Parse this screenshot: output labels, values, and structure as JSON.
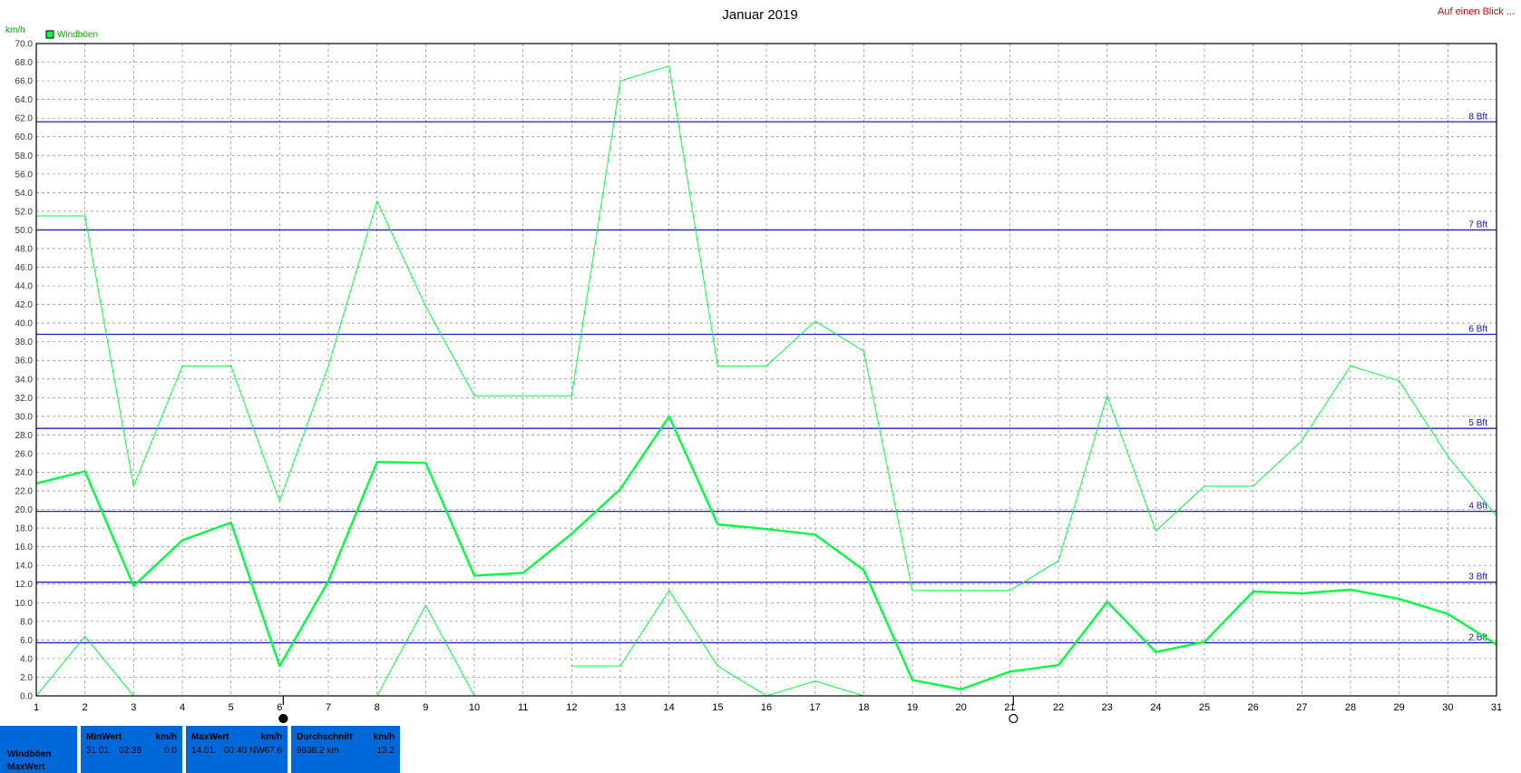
{
  "page": {
    "corner_link": "Auf einen Blick ..."
  },
  "chart_data": {
    "type": "line",
    "title": "Januar 2019",
    "ylabel": "km/h",
    "ylim": [
      0,
      70
    ],
    "ytick_step": 2,
    "ytick_format": 1,
    "x": [
      1,
      2,
      3,
      4,
      5,
      6,
      7,
      8,
      9,
      10,
      11,
      12,
      13,
      14,
      15,
      16,
      17,
      18,
      19,
      20,
      21,
      22,
      23,
      24,
      25,
      26,
      27,
      28,
      29,
      30,
      31
    ],
    "grid": true,
    "legend": {
      "position": "top-left",
      "entries": [
        "Windböen"
      ]
    },
    "colors": {
      "series": "#00ff40",
      "bft_line": "#2020c0",
      "grid": "#888888",
      "frame": "#000000"
    },
    "beaufort_lines": [
      {
        "label": "2 Bft",
        "value": 5.7
      },
      {
        "label": "3 Bft",
        "value": 12.2
      },
      {
        "label": "4 Bft",
        "value": 19.8
      },
      {
        "label": "5 Bft",
        "value": 28.7
      },
      {
        "label": "6 Bft",
        "value": 38.8
      },
      {
        "label": "7 Bft",
        "value": 50.0
      },
      {
        "label": "8 Bft",
        "value": 61.6
      }
    ],
    "series": [
      {
        "name": "Windböen",
        "role": "max",
        "width": 1,
        "values": [
          51.5,
          51.5,
          22.5,
          35.4,
          35.4,
          20.9,
          35.4,
          53.1,
          41.8,
          32.2,
          32.2,
          32.2,
          66.0,
          67.6,
          35.4,
          35.4,
          40.2,
          37.0,
          11.3,
          11.3,
          11.3,
          14.5,
          32.2,
          17.7,
          22.5,
          22.5,
          27.4,
          35.4,
          33.8,
          25.7,
          19.3
        ]
      },
      {
        "role": "avg",
        "width": 2.4,
        "values": [
          22.8,
          24.1,
          11.8,
          16.7,
          18.6,
          3.2,
          12.3,
          25.1,
          25.0,
          12.9,
          13.2,
          17.4,
          22.2,
          30.0,
          18.4,
          17.9,
          17.3,
          13.5,
          1.7,
          0.7,
          2.6,
          3.3,
          10.1,
          4.7,
          5.8,
          11.2,
          11.0,
          11.4,
          10.4,
          8.8,
          5.5
        ]
      },
      {
        "role": "min",
        "width": 1,
        "values": [
          0.0,
          6.4,
          0.0,
          null,
          null,
          null,
          null,
          0.0,
          9.7,
          0.0,
          null,
          3.2,
          3.2,
          11.3,
          3.2,
          0.0,
          1.6,
          0.0,
          null,
          null,
          null,
          null,
          null,
          null,
          null,
          null,
          null,
          null,
          null,
          null,
          null
        ]
      }
    ],
    "moon_markers": [
      {
        "x": 6,
        "phase": "new"
      },
      {
        "x": 21,
        "phase": "full"
      }
    ]
  },
  "stats": {
    "row_label_1": "Windböen",
    "row_label_2": "MaxWert",
    "min": {
      "header": "MinWert",
      "unit": "km/h",
      "date": "31.01.",
      "time": "02:38",
      "value": "0.0"
    },
    "max": {
      "header": "MaxWert",
      "unit": "km/h",
      "date": "14.01.",
      "time": "00:40",
      "dir": "NW",
      "value": "67.6"
    },
    "avg": {
      "header": "Durchschnitt",
      "unit": "km/h",
      "distance": "9838.2 km",
      "value": "13.2"
    }
  }
}
